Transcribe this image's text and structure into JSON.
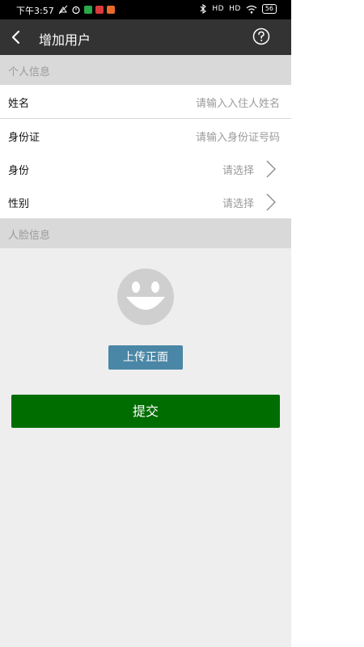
{
  "status_bar": {
    "time": "下午3:57",
    "signal_1": "HD",
    "signal_2": "HD",
    "battery": "56"
  },
  "app_bar": {
    "title": "增加用户"
  },
  "sections": {
    "personal": "个人信息",
    "face": "人脸信息"
  },
  "form": {
    "name": {
      "label": "姓名",
      "placeholder": "请输入入住人姓名"
    },
    "id_card": {
      "label": "身份证",
      "placeholder": "请输入身份证号码"
    },
    "identity": {
      "label": "身份",
      "value": "请选择"
    },
    "gender": {
      "label": "性别",
      "value": "请选择"
    }
  },
  "face": {
    "upload_label": "上传正面"
  },
  "submit_label": "提交",
  "colors": {
    "app_bar": "#333333",
    "section_bg": "#d9d9d9",
    "upload_button": "#4a86a6",
    "submit_button": "#006d00"
  }
}
